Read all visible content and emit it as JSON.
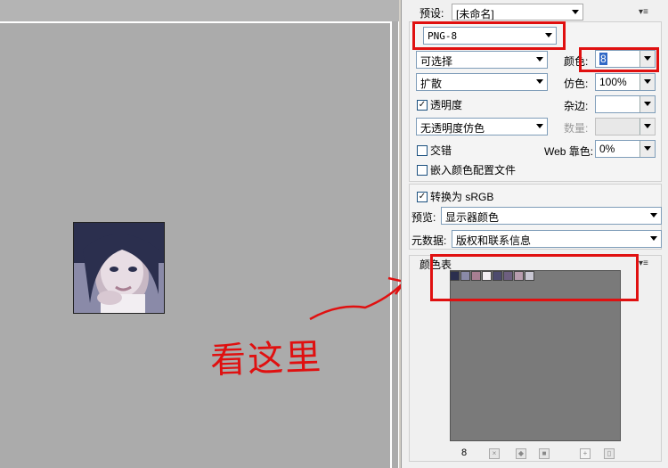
{
  "preset": {
    "label": "预设:",
    "value": "[未命名]"
  },
  "format": {
    "value": "PNG-8"
  },
  "reduction": {
    "value": "可选择"
  },
  "colors": {
    "label": "颜色:",
    "value": "8"
  },
  "dither_algo": {
    "value": "扩散"
  },
  "dither": {
    "label": "仿色:",
    "value": "100%"
  },
  "transparency": {
    "label": "透明度",
    "checked": true
  },
  "matte": {
    "label": "杂边:",
    "value": ""
  },
  "transparency_dither": {
    "value": "无透明度仿色"
  },
  "amount": {
    "label": "数量:",
    "value": ""
  },
  "interlaced": {
    "label": "交错",
    "checked": false
  },
  "web_snap": {
    "label": "Web 靠色:",
    "value": "0%"
  },
  "embed_profile": {
    "label": "嵌入颜色配置文件",
    "checked": false
  },
  "convert_srgb": {
    "label": "转换为 sRGB",
    "checked": true
  },
  "preview": {
    "label": "预览:",
    "value": "显示器颜色"
  },
  "metadata": {
    "label": "元数据:",
    "value": "版权和联系信息"
  },
  "color_table": {
    "title": "颜色表",
    "count": "8",
    "swatches": [
      "#2b2f4e",
      "#8a8aa8",
      "#a87f92",
      "#f2eef2",
      "#4d4b6e",
      "#6d5f80",
      "#b79cae",
      "#c8c6d2"
    ]
  },
  "annotation": {
    "text": "看这里",
    "color": "#e01010"
  }
}
